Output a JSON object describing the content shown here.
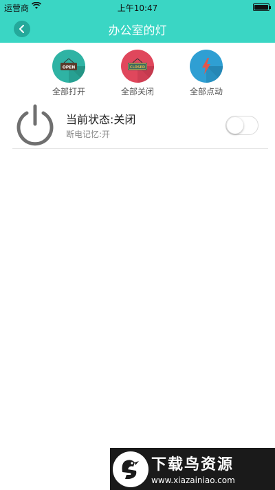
{
  "status_bar": {
    "carrier": "运营商",
    "time": "上午10:47"
  },
  "nav": {
    "title": "办公室的灯",
    "accent": "#3ad6c4"
  },
  "quick_actions": [
    {
      "label": "全部打开",
      "sign": "OPEN",
      "color": "#2fb3a4",
      "icon": "open-sign-icon"
    },
    {
      "label": "全部关闭",
      "sign": "CLOSED",
      "color": "#e0475c",
      "icon": "closed-sign-icon"
    },
    {
      "label": "全部点动",
      "color": "#2f9fd3",
      "icon": "lightning-icon"
    }
  ],
  "device": {
    "state_text": "当前状态:关闭",
    "memory_text": "断电记忆:开",
    "switch_on": false,
    "icon": "power-icon"
  },
  "watermark": {
    "title": "下载鸟资源",
    "url": "www.xiazainiao.com"
  }
}
